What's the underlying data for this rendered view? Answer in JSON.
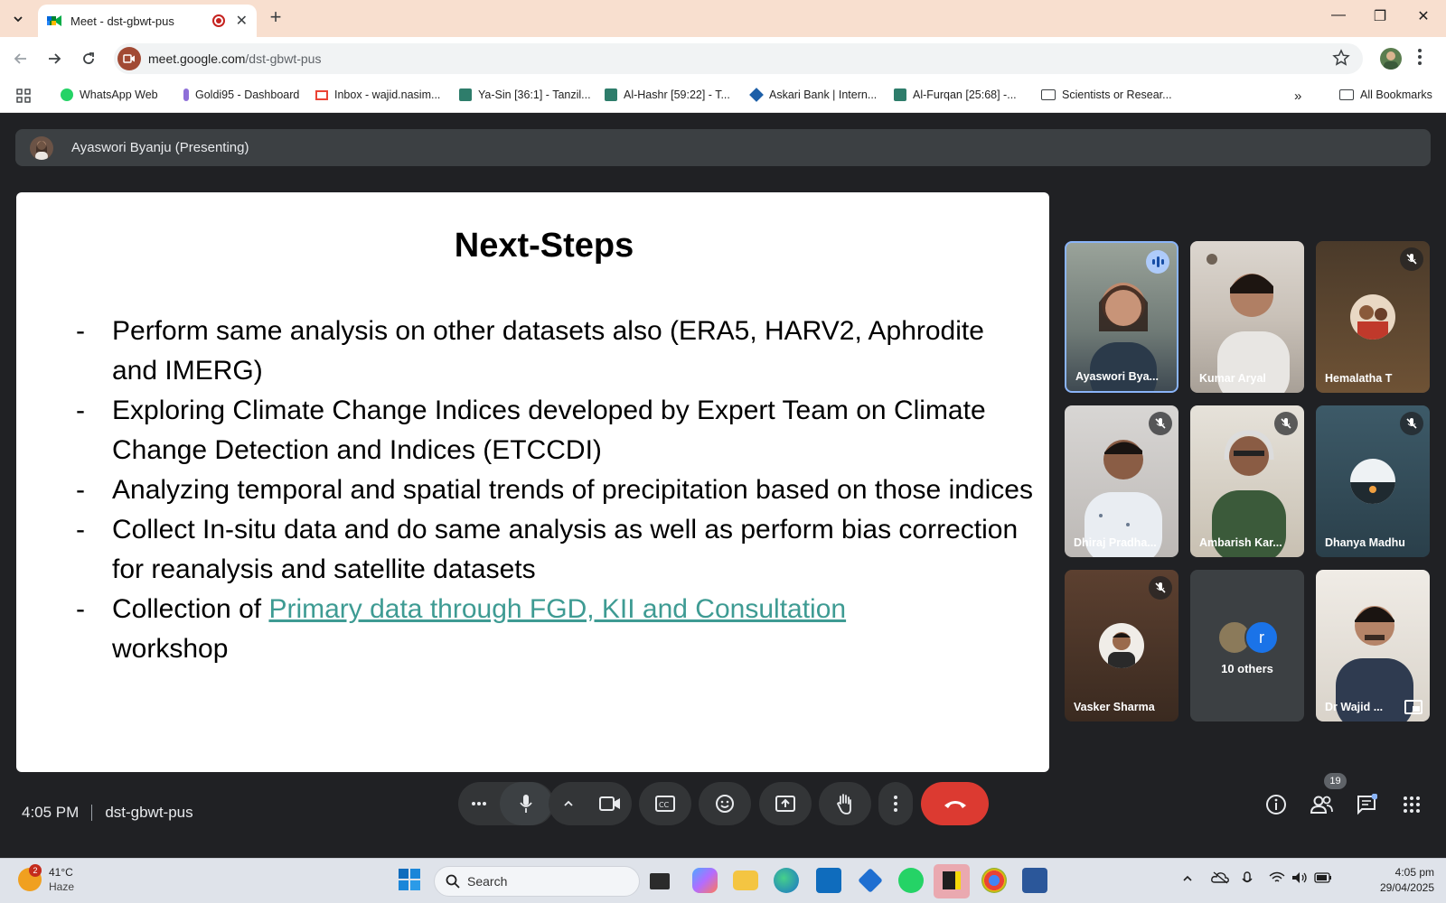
{
  "browser": {
    "tab_title": "Meet - dst-gbwt-pus",
    "url_host": "meet.google.com",
    "url_path": "/dst-gbwt-pus",
    "bookmarks": [
      "WhatsApp Web",
      "Goldi95 - Dashboard",
      "Inbox - wajid.nasim...",
      "Ya-Sin [36:1] - Tanzil...",
      "Al-Hashr [59:22] - T...",
      "Askari Bank | Intern...",
      "Al-Furqan [25:68] -...",
      "Scientists or Resear..."
    ],
    "all_bookmarks": "All Bookmarks"
  },
  "meet": {
    "presenter_banner": "Ayaswori Byanju (Presenting)",
    "slide": {
      "title": "Next-Steps",
      "bullet_marker": "-",
      "bullets": [
        "Perform same analysis on other datasets also (ERA5, HARV2, Aphrodite and IMERG)",
        "Exploring Climate Change Indices developed by Expert Team on Climate Change Detection and Indices (ETCCDI)",
        "Analyzing temporal and spatial trends of precipitation based on those indices",
        "Collect In-situ data and do same analysis as well as perform bias correction for reanalysis and satellite datasets"
      ],
      "last_bullet_prefix": "Collection of ",
      "last_bullet_link": "Primary data through FGD, KII and Consultation",
      "last_bullet_suffix": "workshop"
    },
    "participants": [
      {
        "name": "Ayaswori Bya..."
      },
      {
        "name": "Kumar Aryal"
      },
      {
        "name": "Hemalatha T"
      },
      {
        "name": "Dhiraj Pradha..."
      },
      {
        "name": "Ambarish Kar..."
      },
      {
        "name": "Dhanya Madhu"
      },
      {
        "name": "Vasker Sharma"
      },
      {
        "name": "10 others",
        "avatar_letter": "r"
      },
      {
        "name": "Dr Wajid ..."
      }
    ],
    "time": "4:05 PM",
    "meeting_code": "dst-gbwt-pus",
    "people_count": "19",
    "colors": {
      "end_call": "#dc3a31",
      "link": "#3e9b93",
      "active_border": "#8ab4f8"
    }
  },
  "taskbar": {
    "weather_temp": "41°C",
    "weather_desc": "Haze",
    "weather_badge": "2",
    "search_label": "Search",
    "clock_time": "4:05 pm",
    "clock_date": "29/04/2025"
  }
}
